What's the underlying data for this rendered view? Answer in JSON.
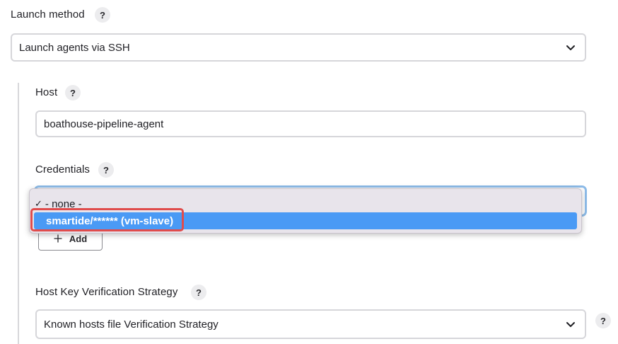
{
  "launch_method": {
    "label": "Launch method",
    "help": "?",
    "value": "Launch agents via SSH"
  },
  "host": {
    "label": "Host",
    "help": "?",
    "value": "boathouse-pipeline-agent"
  },
  "credentials": {
    "label": "Credentials",
    "help": "?",
    "options": [
      {
        "check": "✓",
        "label": "- none -"
      },
      {
        "label": "smartide/****** (vm-slave)"
      }
    ],
    "add_label": "Add",
    "add_icon": "plus-icon"
  },
  "host_key": {
    "label": "Host Key Verification Strategy",
    "help": "?",
    "value": "Known hosts file Verification Strategy",
    "side_help": "?"
  },
  "colors": {
    "selected_option": "#4a9af5",
    "highlight_border": "#e04c4c",
    "focus_ring": "#8dbbe8"
  }
}
